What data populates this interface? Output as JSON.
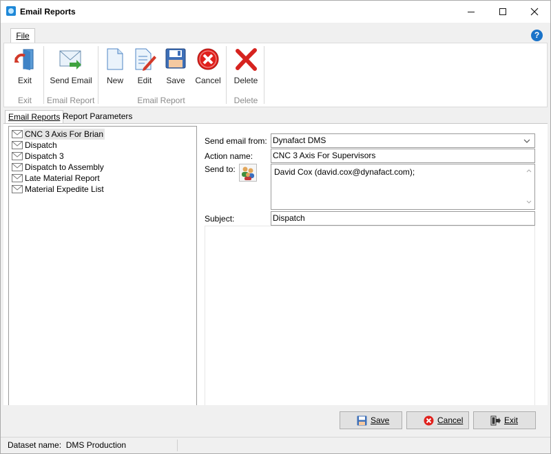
{
  "window": {
    "title": "Email Reports"
  },
  "ribbon": {
    "tab_file": "File",
    "buttons": {
      "exit": "Exit",
      "send_email": "Send Email",
      "new": "New",
      "edit": "Edit",
      "save": "Save",
      "cancel": "Cancel",
      "delete": "Delete"
    },
    "groups": {
      "exit": "Exit",
      "email_report_1": "Email Report",
      "email_report_2": "Email Report",
      "delete": "Delete"
    }
  },
  "tabs": {
    "email_reports": "Email Reports",
    "report_parameters": "Report Parameters"
  },
  "report_list": [
    {
      "label": "CNC 3 Axis For Brian",
      "selected": true
    },
    {
      "label": "Dispatch",
      "selected": false
    },
    {
      "label": "Dispatch 3",
      "selected": false
    },
    {
      "label": "Dispatch to Assembly",
      "selected": false
    },
    {
      "label": "Late Material Report",
      "selected": false
    },
    {
      "label": "Material Expedite List",
      "selected": false
    }
  ],
  "form": {
    "send_from_label": "Send email from:",
    "send_from_value": "Dynafact DMS",
    "action_name_label": "Action name:",
    "action_name_value": "CNC 3 Axis For Supervisors",
    "send_to_label": "Send to:",
    "send_to_value": "David Cox (david.cox@dynafact.com);",
    "subject_label": "Subject:",
    "subject_value": "Dispatch"
  },
  "bottom_buttons": {
    "save": "Save",
    "cancel": "Cancel",
    "exit": "Exit"
  },
  "status": {
    "dataset": "Dataset name:  DMS Production"
  }
}
